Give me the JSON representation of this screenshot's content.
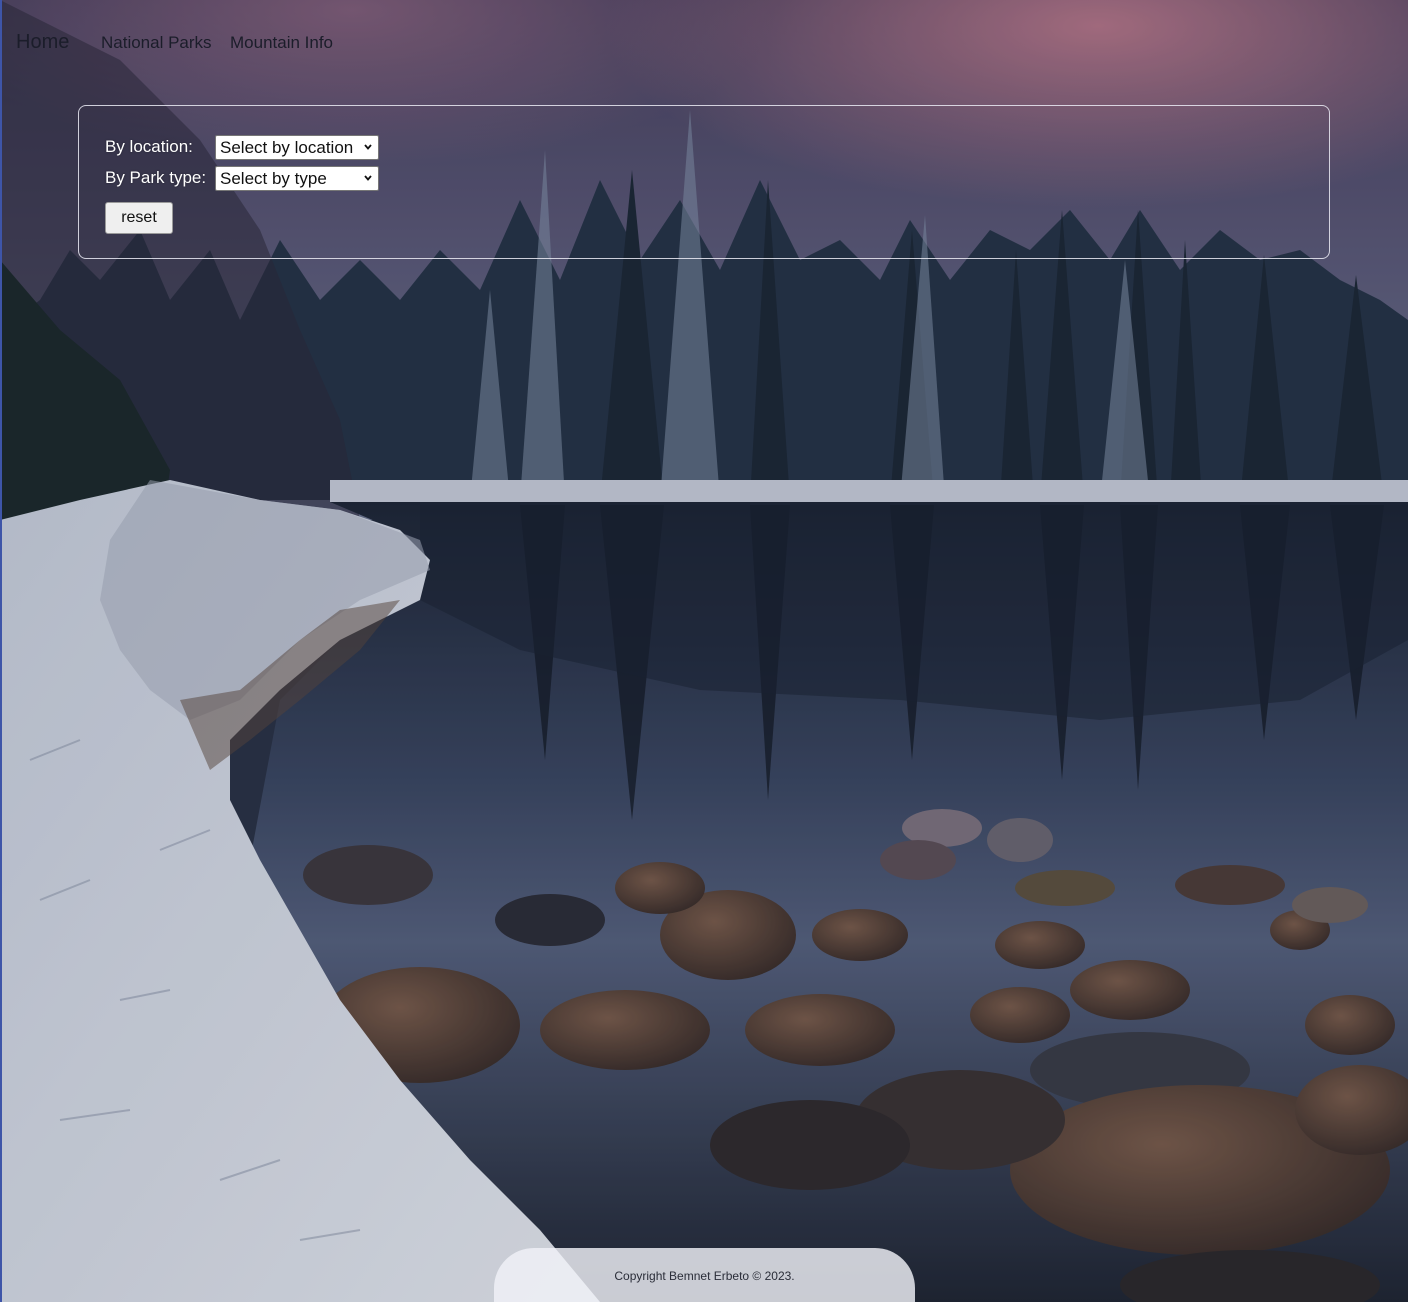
{
  "nav": {
    "brand": "Home",
    "links": [
      {
        "label": "National Parks"
      },
      {
        "label": "Mountain Info"
      }
    ]
  },
  "filters": {
    "location_label": "By location:",
    "location_selected": "Select by location",
    "type_label": "By Park type:",
    "type_selected": "Select by type",
    "reset_label": "reset"
  },
  "footer": {
    "copyright": "Copyright Bemnet Erbeto © 2023."
  },
  "icons": {
    "dropdown": "chevron-down-icon"
  },
  "colors": {
    "sky_top": "#3b3a5c",
    "sky_glow": "#b7788f",
    "forest": "#1e2c3a",
    "snow": "#d7dde8",
    "water": "#27344a",
    "panel_border": "#ebebf5"
  }
}
